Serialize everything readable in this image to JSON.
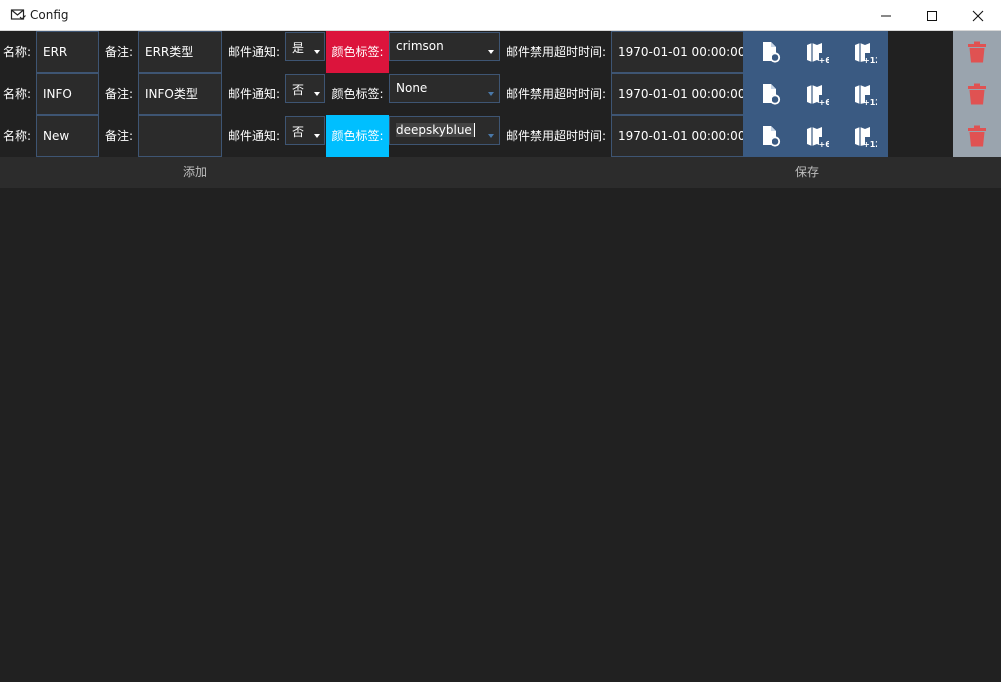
{
  "window": {
    "title": "Config",
    "icon": "mail-icon",
    "minimize_icon": "minimize-icon",
    "maximize_icon": "maximize-icon",
    "close_icon": "close-icon"
  },
  "labels": {
    "name": "名称:",
    "remark": "备注:",
    "mail_notify": "邮件通知:",
    "color_tag": "颜色标签:",
    "mail_disable_timeout": "邮件禁用超时时间:"
  },
  "rows": [
    {
      "name": "ERR",
      "remark": "ERR类型",
      "mail_notify": "是",
      "color": "crimson",
      "color_hex": "#dc143c",
      "timeout": "1970-01-01 00:00:00"
    },
    {
      "name": "INFO",
      "remark": "INFO类型",
      "mail_notify": "否",
      "color": "None",
      "color_hex": "",
      "timeout": "1970-01-01 00:00:00"
    },
    {
      "name": "New",
      "remark": "",
      "mail_notify": "否",
      "color": "deepskyblue",
      "color_hex": "#00bfff",
      "timeout": "1970-01-01 00:00:00"
    }
  ],
  "actions": {
    "reset_icon": "file-reset-icon",
    "plus6_icon": "map-plus6-icon",
    "plus12_icon": "map-plus12-icon",
    "plus6_text": "+6",
    "plus12_text": "+12",
    "delete_icon": "trash-icon",
    "accent_color": "#3a5a82",
    "delete_color": "#e05252"
  },
  "footer": {
    "add": "添加",
    "save": "保存"
  }
}
